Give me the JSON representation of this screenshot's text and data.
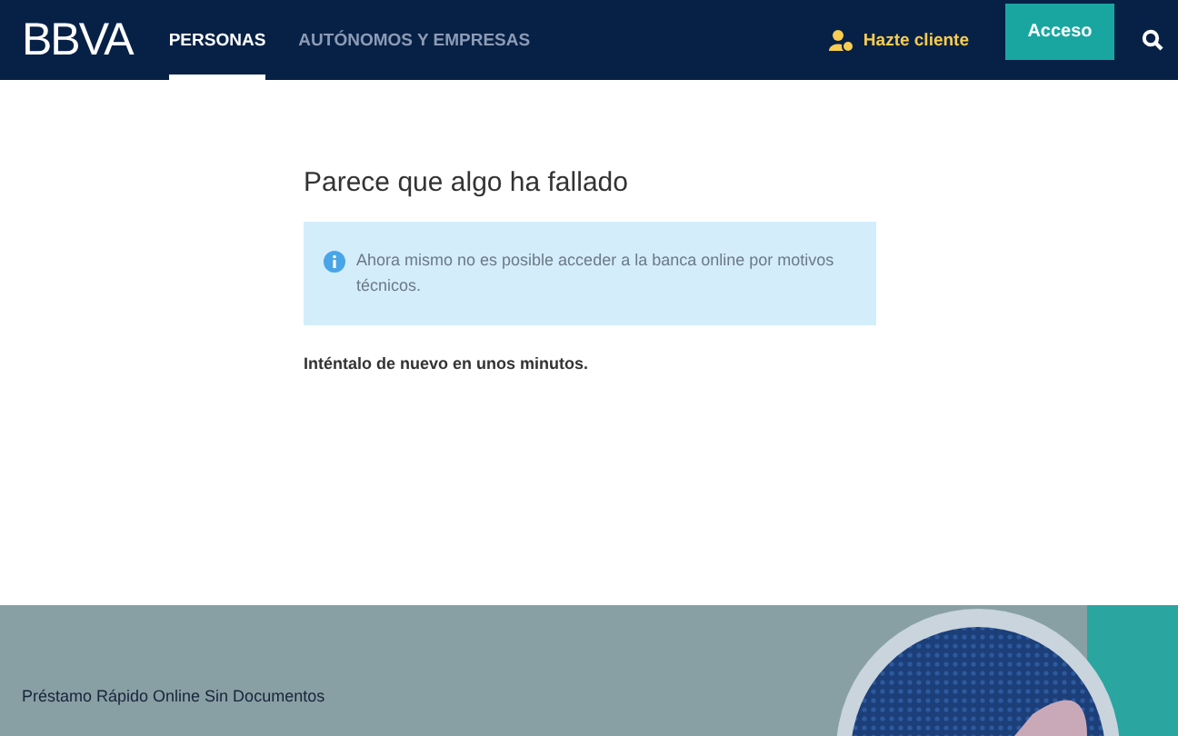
{
  "header": {
    "logo": "BBVA",
    "tabs": [
      {
        "label": "PERSONAS",
        "selected": true
      },
      {
        "label": "AUTÓNOMOS Y EMPRESAS",
        "selected": false
      }
    ],
    "signup_link": "Hazte cliente",
    "login_button": "Acceso"
  },
  "error": {
    "title": "Parece que algo ha fallado",
    "notice": "Ahora mismo no es posible acceder a la banca online por motivos técnicos.",
    "retry": "Inténtalo de nuevo en unos minutos."
  },
  "banner": {
    "eyebrow": "Préstamo Rápido Online Sin Documentos"
  }
}
